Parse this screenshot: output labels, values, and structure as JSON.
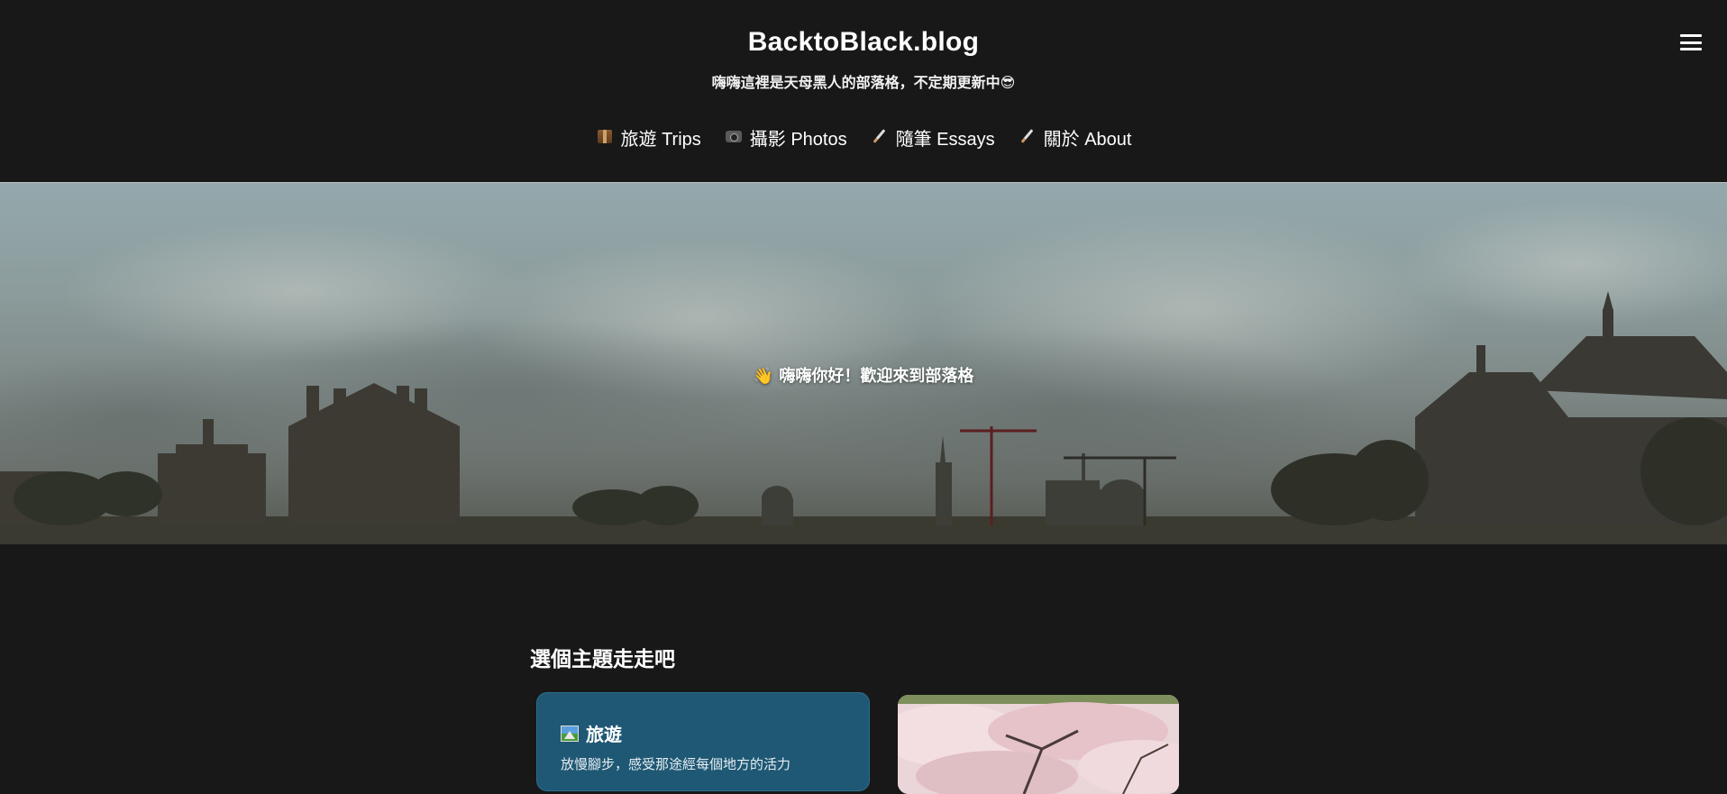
{
  "site": {
    "title": "BacktoBlack.blog",
    "tagline": "嗨嗨這裡是天母黑人的部落格，不定期更新中😎"
  },
  "header": {
    "menu_icon": "hamburger-menu-icon"
  },
  "nav": {
    "items": [
      {
        "label": "旅遊 Trips",
        "icon": "package-icon"
      },
      {
        "label": "攝影 Photos",
        "icon": "camera-flash-icon"
      },
      {
        "label": "隨筆 Essays",
        "icon": "paintbrush-icon"
      },
      {
        "label": "關於 About",
        "icon": "paintbrush-icon"
      }
    ]
  },
  "hero": {
    "greeting": "👋 嗨嗨你好！歡迎來到部落格",
    "image": "paris-skyline-cloudy-sky"
  },
  "topics": {
    "heading": "選個主題走走吧",
    "cards": [
      {
        "title": "旅遊",
        "icon": "landscape-picture-icon",
        "description": "放慢腳步，感受那途經每個地方的活力",
        "background_color": "#1f5874"
      },
      {
        "image": "cherry-blossom-photo"
      }
    ]
  },
  "colors": {
    "page_background": "#181818",
    "card_accent": "#1f5874",
    "text": "#ffffff"
  }
}
